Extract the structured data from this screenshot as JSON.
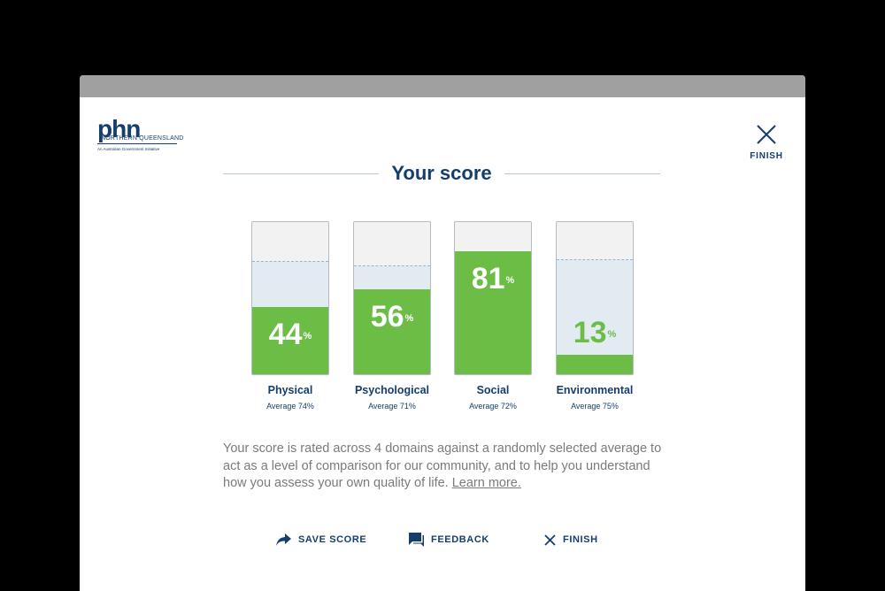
{
  "logo": {
    "main": "phn",
    "sub": "NORTHERN QUEENSLAND",
    "tagline": "An Australian Government Initiative"
  },
  "close": {
    "label": "FINISH",
    "icon": "close-icon"
  },
  "heading": "Your score",
  "colors": {
    "brand": "#153e6d",
    "green": "#6bbd45",
    "average_band": "#e3ebf2"
  },
  "domains": [
    {
      "name": "Physical",
      "score": 44,
      "score_text": "44",
      "average": 74,
      "average_label": "Average 74%"
    },
    {
      "name": "Psychological",
      "score": 56,
      "score_text": "56",
      "average": 71,
      "average_label": "Average 71%"
    },
    {
      "name": "Social",
      "score": 81,
      "score_text": "81",
      "average": 72,
      "average_label": "Average 72%"
    },
    {
      "name": "Environmental",
      "score": 13,
      "score_text": "13",
      "average": 75,
      "average_label": "Average 75%"
    }
  ],
  "percent_sign": "%",
  "description": "Your score is rated across 4 domains against a randomly selected average to act as a level of comparison for our community, and to help you understand how you assess your own quality of life.",
  "learn_more": "Learn more.",
  "actions": {
    "save": {
      "label": "SAVE SCORE",
      "icon": "share-arrow-icon"
    },
    "feedback": {
      "label": "FEEDBACK",
      "icon": "chat-bubble-icon"
    },
    "finish": {
      "label": "FINISH",
      "icon": "close-icon"
    }
  }
}
